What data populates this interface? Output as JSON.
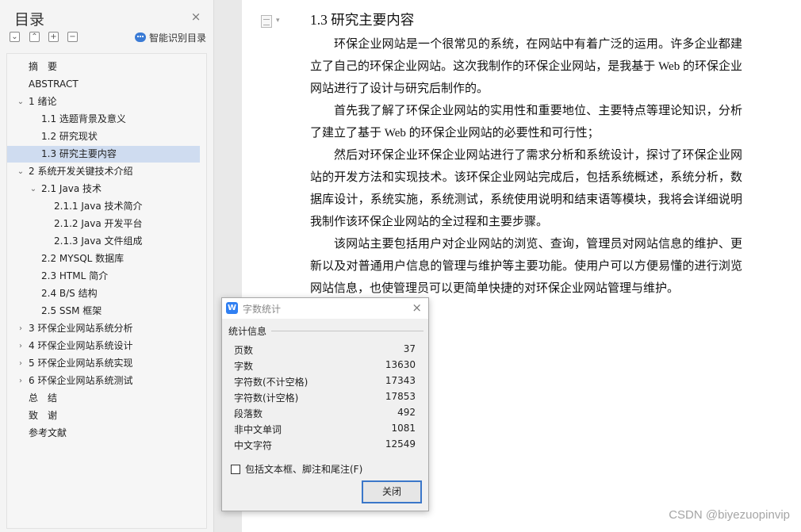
{
  "sidebar": {
    "title": "目录",
    "close_icon": "×",
    "tools": [
      "⌄",
      "⌃",
      "+",
      "−"
    ],
    "smart_toc_label": "智能识别目录",
    "items": [
      {
        "label": "摘　要",
        "level": 1,
        "arrow": ""
      },
      {
        "label": "ABSTRACT",
        "level": 1,
        "arrow": ""
      },
      {
        "label": "1 绪论",
        "level": 1,
        "arrow": "⌄"
      },
      {
        "label": "1.1 选题背景及意义",
        "level": 2,
        "arrow": ""
      },
      {
        "label": "1.2 研究现状",
        "level": 2,
        "arrow": ""
      },
      {
        "label": "1.3 研究主要内容",
        "level": 2,
        "arrow": "",
        "selected": true
      },
      {
        "label": "2 系统开发关键技术介绍",
        "level": 1,
        "arrow": "⌄"
      },
      {
        "label": "2.1 Java 技术",
        "level": 2,
        "arrow": "⌄"
      },
      {
        "label": "2.1.1 Java 技术简介",
        "level": 3,
        "arrow": ""
      },
      {
        "label": "2.1.2 Java 开发平台",
        "level": 3,
        "arrow": ""
      },
      {
        "label": "2.1.3 Java 文件组成",
        "level": 3,
        "arrow": ""
      },
      {
        "label": "2.2 MYSQL 数据库",
        "level": 2,
        "arrow": ""
      },
      {
        "label": "2.3 HTML 简介",
        "level": 2,
        "arrow": ""
      },
      {
        "label": "2.4 B/S 结构",
        "level": 2,
        "arrow": ""
      },
      {
        "label": "2.5 SSM 框架",
        "level": 2,
        "arrow": ""
      },
      {
        "label": "3 环保企业网站系统分析",
        "level": 1,
        "arrow": "›"
      },
      {
        "label": "4 环保企业网站系统设计",
        "level": 1,
        "arrow": "›"
      },
      {
        "label": "5 环保企业网站系统实现",
        "level": 1,
        "arrow": "›"
      },
      {
        "label": "6 环保企业网站系统测试",
        "level": 1,
        "arrow": "›"
      },
      {
        "label": "总　结",
        "level": 1,
        "arrow": ""
      },
      {
        "label": "致　谢",
        "level": 1,
        "arrow": ""
      },
      {
        "label": "参考文献",
        "level": 1,
        "arrow": ""
      }
    ]
  },
  "document": {
    "heading": "1.3 研究主要内容",
    "paragraphs": [
      "环保企业网站是一个很常见的系统，在网站中有着广泛的运用。许多企业都建立了自己的环保企业网站。这次我制作的环保企业网站，是我基于 Web 的环保企业网站进行了设计与研究后制作的。",
      "首先我了解了环保企业网站的实用性和重要地位、主要特点等理论知识，分析了建立了基于 Web 的环保企业网站的必要性和可行性；",
      "然后对环保企业环保企业网站进行了需求分析和系统设计，探讨了环保企业网站的开发方法和实现技术。该环保企业网站完成后，包括系统概述，系统分析，数据库设计，系统实施，系统测试，系统使用说明和结束语等模块，我将会详细说明我制作该环保企业网站的全过程和主要步骤。",
      "该网站主要包括用户对企业网站的浏览、查询，管理员对网站信息的维护、更新以及对普通用户信息的管理与维护等主要功能。使用户可以方便易懂的进行浏览网站信息，也使管理员可以更简单快捷的对环保企业网站管理与维护。"
    ]
  },
  "dialog": {
    "app_icon_text": "W",
    "title": "字数统计",
    "close_icon": "×",
    "section": "统计信息",
    "stats": [
      {
        "label": "页数",
        "value": "37"
      },
      {
        "label": "字数",
        "value": "13630"
      },
      {
        "label": "字符数(不计空格)",
        "value": "17343"
      },
      {
        "label": "字符数(计空格)",
        "value": "17853"
      },
      {
        "label": "段落数",
        "value": "492"
      },
      {
        "label": "非中文单词",
        "value": "1081"
      },
      {
        "label": "中文字符",
        "value": "12549"
      }
    ],
    "checkbox_label": "包括文本框、脚注和尾注(F)",
    "checkbox_checked": false,
    "close_button": "关闭"
  },
  "watermark": "CSDN @biyezuopinvip",
  "colors": {
    "selection": "#cfdcf0",
    "accent": "#3b77c9",
    "sidebar_bg": "#f4f4f4"
  }
}
